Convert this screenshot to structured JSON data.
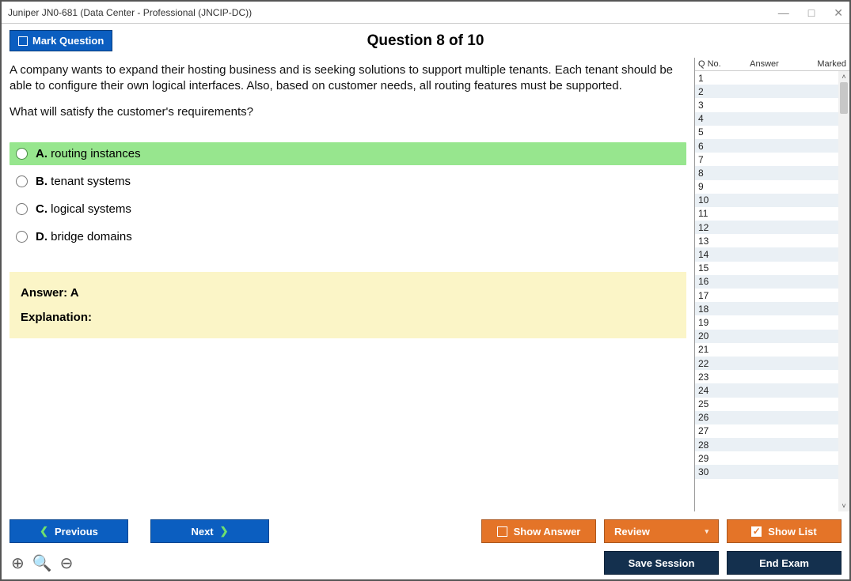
{
  "titlebar": {
    "title": "Juniper JN0-681 (Data Center - Professional (JNCIP-DC))"
  },
  "header": {
    "mark_label": "Mark Question",
    "question_header": "Question 8 of 10"
  },
  "question": {
    "para1": "A company wants to expand their hosting business and is seeking solutions to support multiple tenants. Each tenant should be able to configure their own logical interfaces. Also, based on customer needs, all routing features must be supported.",
    "para2": "What will satisfy the customer's requirements?"
  },
  "options": [
    {
      "letter": "A.",
      "text": "routing instances",
      "correct": true
    },
    {
      "letter": "B.",
      "text": "tenant systems",
      "correct": false
    },
    {
      "letter": "C.",
      "text": "logical systems",
      "correct": false
    },
    {
      "letter": "D.",
      "text": "bridge domains",
      "correct": false
    }
  ],
  "answer_block": {
    "answer_line": "Answer: A",
    "explanation_label": "Explanation:"
  },
  "side": {
    "headers": {
      "qno": "Q No.",
      "answer": "Answer",
      "marked": "Marked"
    },
    "rows": [
      1,
      2,
      3,
      4,
      5,
      6,
      7,
      8,
      9,
      10,
      11,
      12,
      13,
      14,
      15,
      16,
      17,
      18,
      19,
      20,
      21,
      22,
      23,
      24,
      25,
      26,
      27,
      28,
      29,
      30
    ]
  },
  "footer": {
    "previous": "Previous",
    "next": "Next",
    "show_answer": "Show Answer",
    "review": "Review",
    "show_list": "Show List",
    "save_session": "Save Session",
    "end_exam": "End Exam"
  },
  "icons": {
    "zoom_in": "⊕",
    "zoom_reset": "🔍",
    "zoom_out": "⊖"
  }
}
